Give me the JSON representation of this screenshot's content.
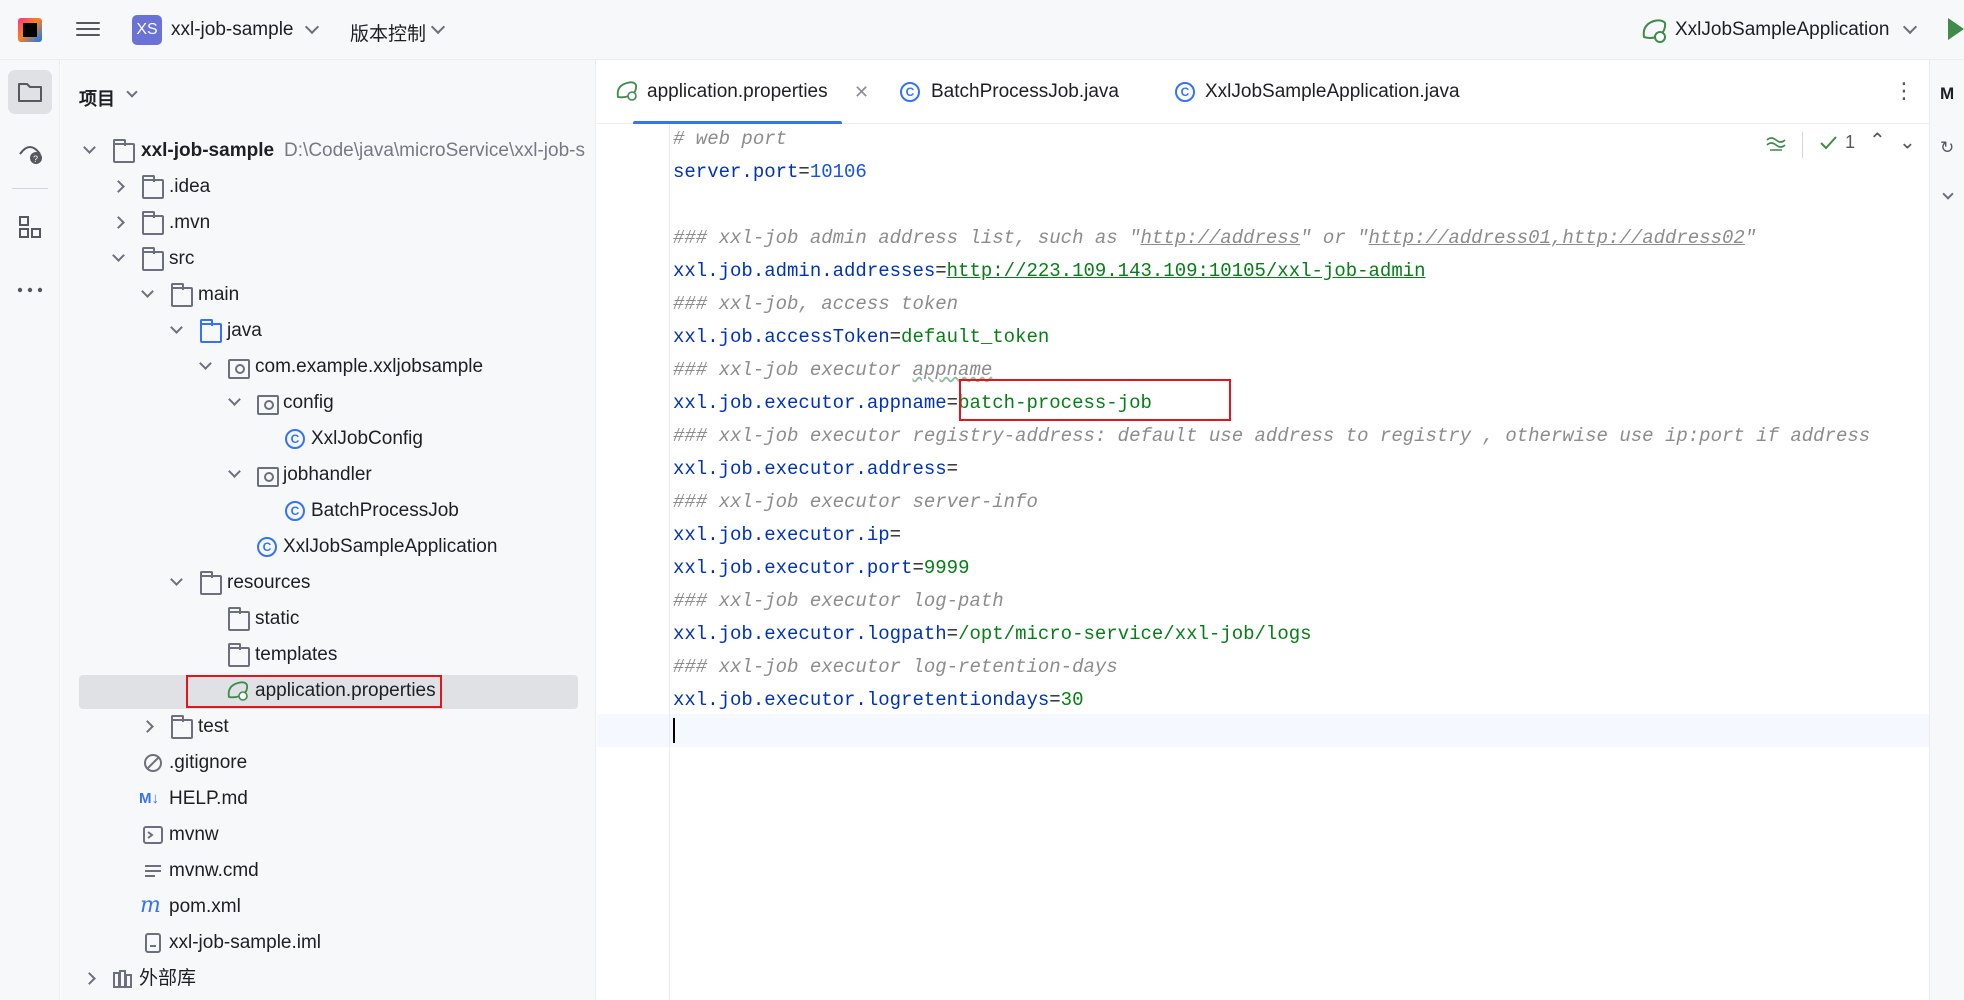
{
  "topbar": {
    "project_badge": "XS",
    "project_name": "xxl-job-sample",
    "vcs_label": "版本控制",
    "run_config": "XxlJobSampleApplication"
  },
  "panel": {
    "title": "项目",
    "tree": [
      {
        "label": "xxl-job-sample",
        "path": "D:\\Code\\java\\microService\\xxl-job-s",
        "bold": true
      },
      {
        "label": ".idea"
      },
      {
        "label": ".mvn"
      },
      {
        "label": "src"
      },
      {
        "label": "main"
      },
      {
        "label": "java"
      },
      {
        "label": "com.example.xxljobsample"
      },
      {
        "label": "config"
      },
      {
        "label": "XxlJobConfig"
      },
      {
        "label": "jobhandler"
      },
      {
        "label": "BatchProcessJob"
      },
      {
        "label": "XxlJobSampleApplication"
      },
      {
        "label": "resources"
      },
      {
        "label": "static"
      },
      {
        "label": "templates"
      },
      {
        "label": "application.properties"
      },
      {
        "label": "test"
      },
      {
        "label": ".gitignore"
      },
      {
        "label": "HELP.md"
      },
      {
        "label": "mvnw"
      },
      {
        "label": "mvnw.cmd"
      },
      {
        "label": "pom.xml"
      },
      {
        "label": "xxl-job-sample.iml"
      },
      {
        "label": "外部库"
      }
    ]
  },
  "tabs": [
    {
      "label": "application.properties",
      "active": true
    },
    {
      "label": "BatchProcessJob.java"
    },
    {
      "label": "XxlJobSampleApplication.java"
    }
  ],
  "editor": {
    "inspection_count": "1",
    "lines": {
      "c1": "# web port",
      "k2": "server.port",
      "v2": "10106",
      "c4a": "### xxl-job admin address list, such as \"",
      "c4u1": "http://address",
      "c4b": "\" or \"",
      "c4u2": "http://address01,http://address02",
      "c4c": "\"",
      "k5": "xxl.job.admin.addresses",
      "v5": "http://223.109.143.109:10105/xxl-job-admin",
      "c6": "### xxl-job, access token",
      "k7": "xxl.job.accessToken",
      "v7": "default_token",
      "c8a": "### xxl-job executor ",
      "c8u": "appname",
      "k9": "xxl.job.executor.appname",
      "v9": "batch-process-job",
      "c10": "### xxl-job executor registry-address: default use address to registry , otherwise use ip:port if address",
      "k11": "xxl.job.executor.address",
      "c12": "### xxl-job executor server-info",
      "k13": "xxl.job.executor.ip",
      "k14": "xxl.job.executor.port",
      "v14": "9999",
      "c15": "### xxl-job executor log-path",
      "k16": "xxl.job.executor.logpath",
      "v16": "/opt/micro-service/xxl-job/logs",
      "c17": "### xxl-job executor log-retention-days",
      "k18": "xxl.job.executor.logretentiondays",
      "v18": "30",
      "eq": "="
    }
  },
  "colors": {
    "accent": "#3574f0",
    "highlight_box": "#e3141b",
    "key": "#0033b3",
    "value": "#067d17",
    "comment": "#8c8c8c"
  }
}
